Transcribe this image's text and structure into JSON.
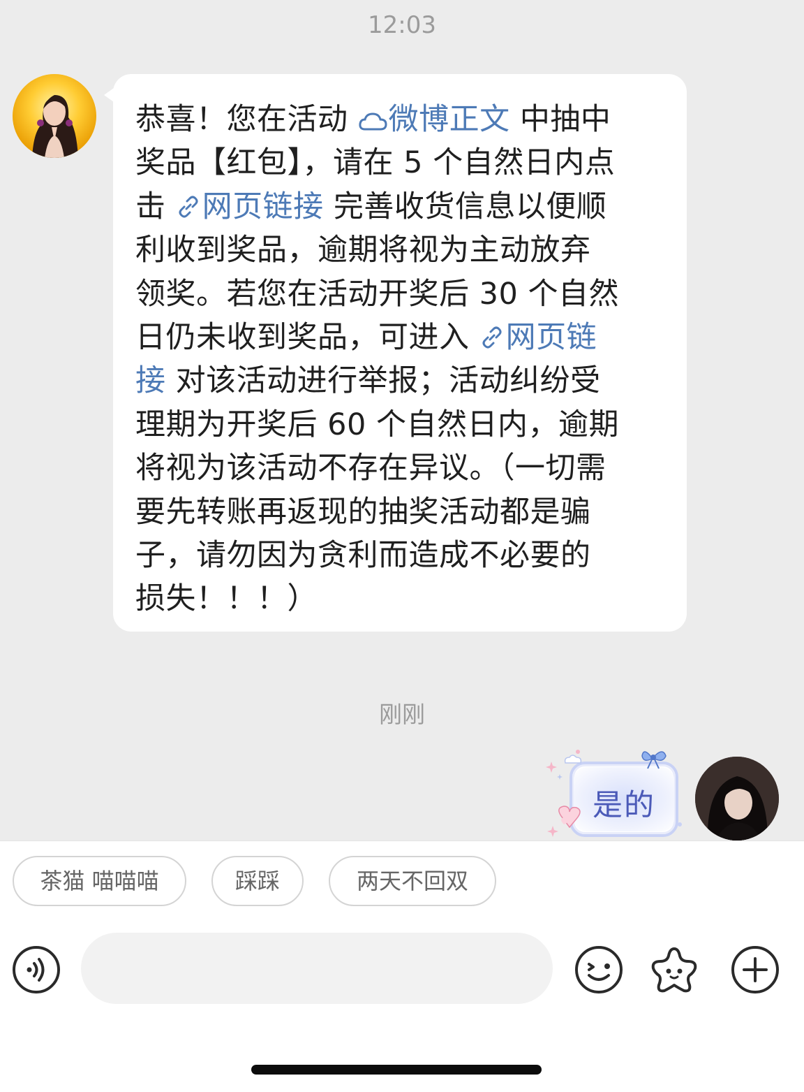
{
  "chat": {
    "timestamp_top": "12:03",
    "timestamp_recent": "刚刚",
    "incoming_message": {
      "lines": [
        {
          "pre": "恭喜！您在活动 ",
          "link": "微博正文",
          "link_icon": "weibo-cloud-icon",
          "post": " 中抽中"
        },
        {
          "pre": "奖品【红包】，请在 5 个自然日内点",
          "link": "",
          "post": ""
        },
        {
          "pre": "击 ",
          "link": "网页链接",
          "link_icon": "link-icon",
          "post": " 完善收货信息以便顺"
        },
        {
          "pre": "利收到奖品，逾期将视为主动放弃",
          "link": "",
          "post": ""
        },
        {
          "pre": "领奖。若您在活动开奖后 30 个自然",
          "link": "",
          "post": ""
        },
        {
          "pre": "日仍未收到奖品，可进入 ",
          "link": "网页链",
          "link_icon": "link-icon",
          "post": ""
        },
        {
          "pre": "",
          "link": "接",
          "post": " 对该活动进行举报；活动纠纷受"
        },
        {
          "pre": "理期为开奖后 60 个自然日内，逾期",
          "link": "",
          "post": ""
        },
        {
          "pre": "将视为该活动不存在异议。（一切需",
          "link": "",
          "post": ""
        },
        {
          "pre": "要先转账再返现的抽奖活动都是骗",
          "link": "",
          "post": ""
        },
        {
          "pre": "子，请勿因为贪利而造成不必要的",
          "link": "",
          "post": ""
        },
        {
          "pre": "损失！！！）",
          "link": "",
          "post": ""
        }
      ]
    },
    "outgoing_sticker_text": "是的"
  },
  "quick_replies": [
    "茶猫 喵喵喵",
    "踩踩",
    "两天不回双"
  ],
  "composer": {
    "input_value": "",
    "voice_icon": "voice-icon",
    "emoji_icon": "emoji-icon",
    "sticker_icon": "sticker-icon",
    "plus_icon": "plus-icon"
  },
  "colors": {
    "link": "#4d7ab6",
    "chat_bg": "#ececec",
    "timestamp": "#9b9b9b"
  }
}
